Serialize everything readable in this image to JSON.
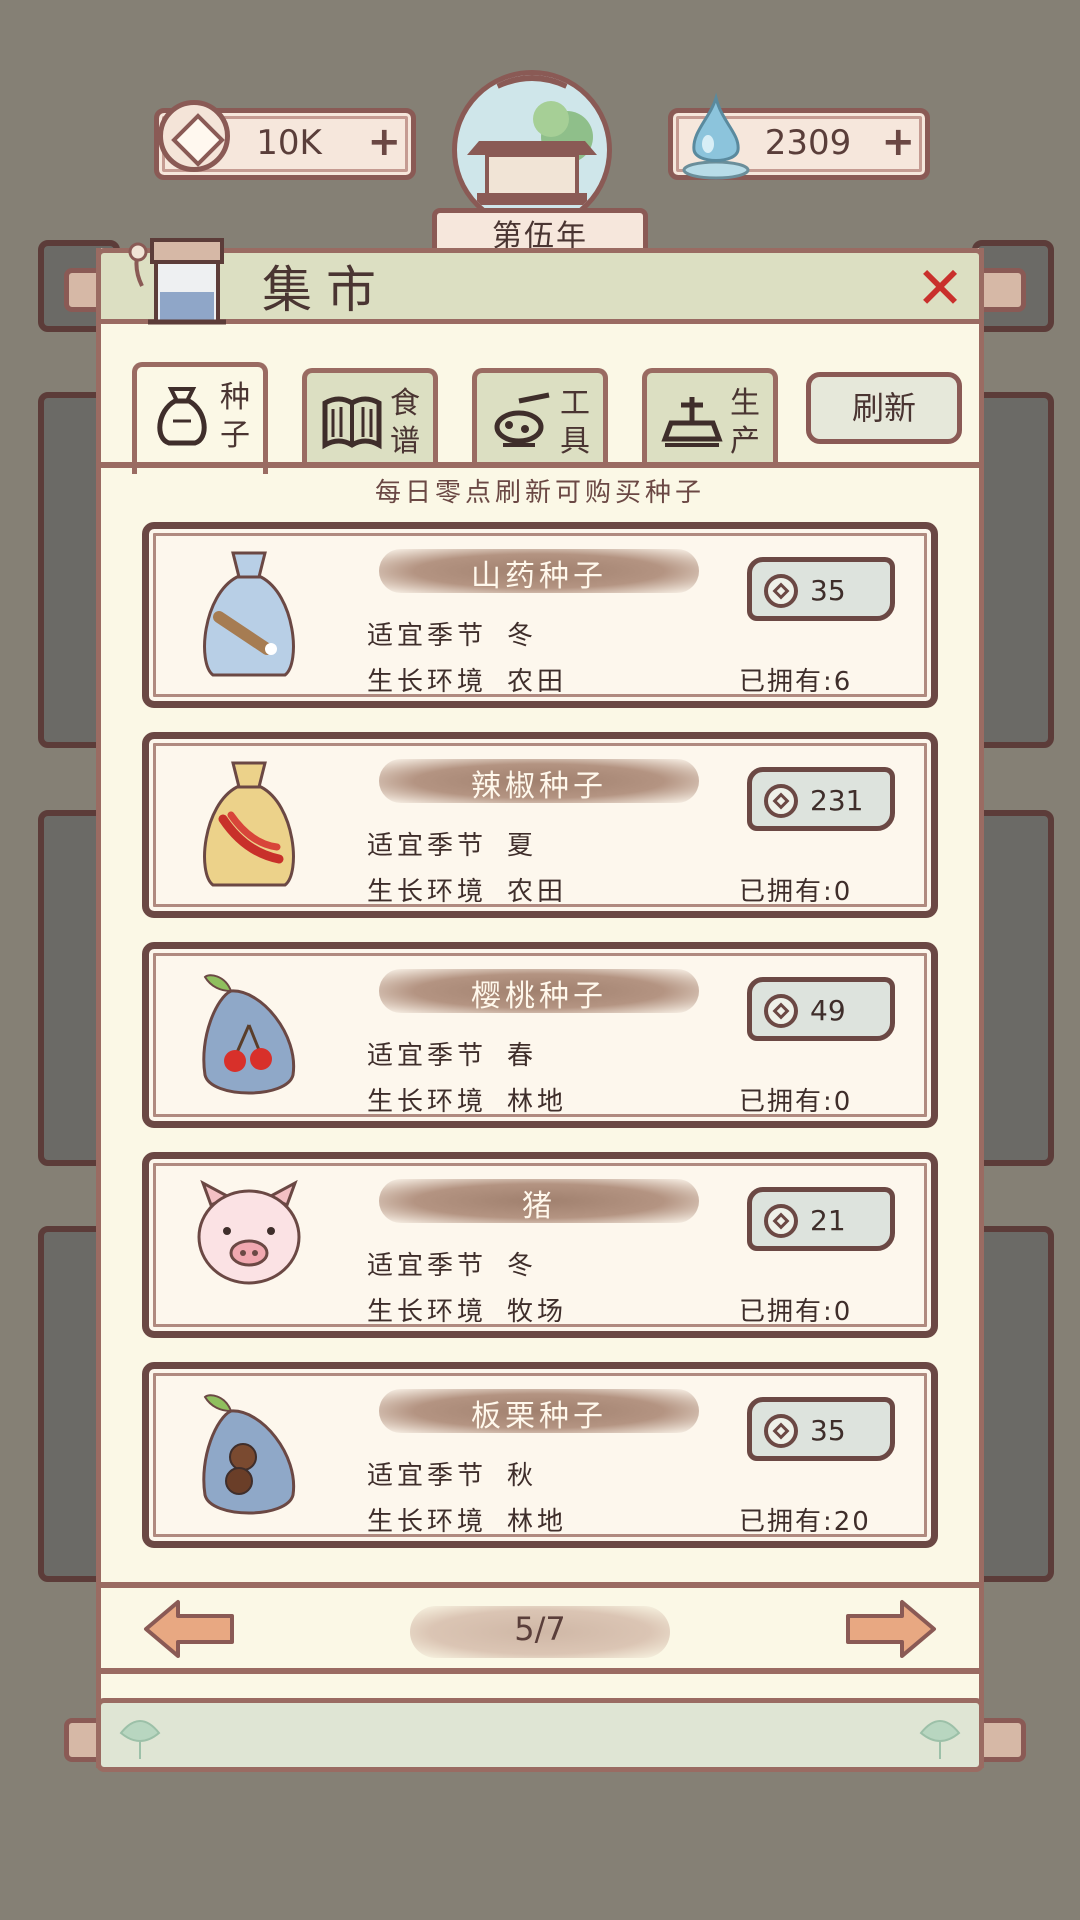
{
  "hud": {
    "coins": "10K",
    "gems": "2309",
    "plus": "+",
    "year": "第伍年"
  },
  "market": {
    "title": "集市",
    "close": "✕",
    "refresh": "刷新",
    "notice": "每日零点刷新可购买种子"
  },
  "tabs": [
    {
      "label": "种子",
      "icon": "seed-bag-icon",
      "active": true
    },
    {
      "label": "食谱",
      "icon": "recipe-book-icon",
      "active": false
    },
    {
      "label": "工具",
      "icon": "tools-icon",
      "active": false
    },
    {
      "label": "生产",
      "icon": "production-icon",
      "active": false
    }
  ],
  "labels": {
    "season": "适宜季节",
    "environment": "生长环境"
  },
  "items": [
    {
      "name": "山药种子",
      "season": "冬",
      "environment": "农田",
      "price": "35",
      "owned": "已拥有:6",
      "icon": "yam-seed-bag-icon"
    },
    {
      "name": "辣椒种子",
      "season": "夏",
      "environment": "农田",
      "price": "231",
      "owned": "已拥有:0",
      "icon": "chili-seed-bag-icon"
    },
    {
      "name": "樱桃种子",
      "season": "春",
      "environment": "林地",
      "price": "49",
      "owned": "已拥有:0",
      "icon": "cherry-seed-bag-icon"
    },
    {
      "name": "猪",
      "season": "冬",
      "environment": "牧场",
      "price": "21",
      "owned": "已拥有:0",
      "icon": "pig-icon"
    },
    {
      "name": "板栗种子",
      "season": "秋",
      "environment": "林地",
      "price": "35",
      "owned": "已拥有:20",
      "icon": "chestnut-seed-bag-icon"
    }
  ],
  "pager": {
    "page": "5/7"
  },
  "colors": {
    "background": "#858075",
    "panel": "#fbf8e6",
    "border": "#9a6b62",
    "close": "#c9302c"
  }
}
